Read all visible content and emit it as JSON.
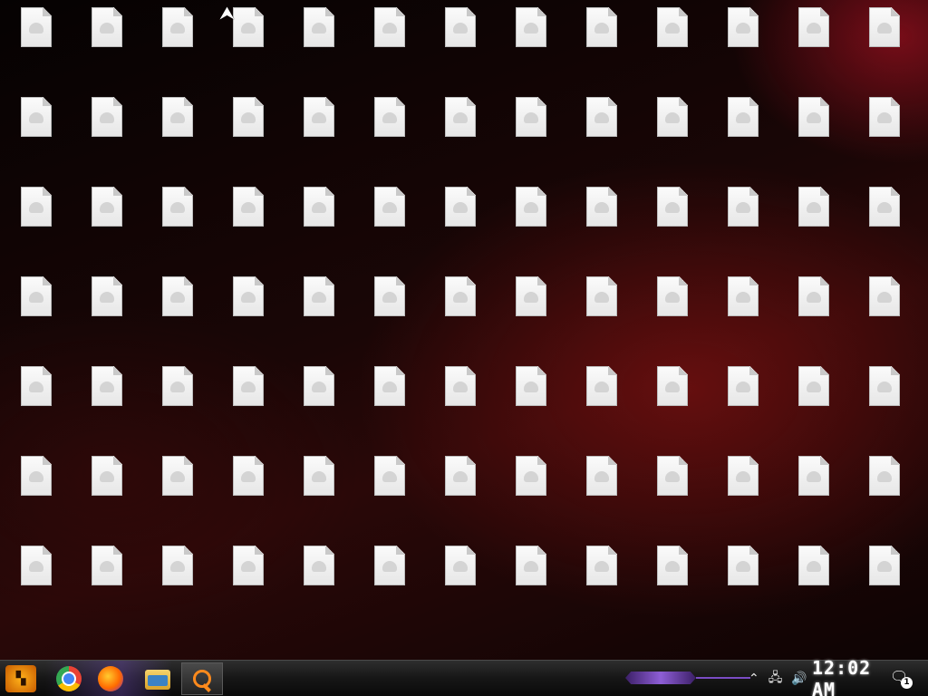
{
  "desktop": {
    "columns": 13,
    "rows": 7,
    "icon_type": "generic-file-icon",
    "labels": [
      "",
      "",
      "",
      "",
      "",
      "",
      "",
      "",
      "",
      "",
      "",
      "",
      "",
      "",
      "",
      "",
      "",
      "",
      "",
      "",
      "",
      "",
      "",
      "",
      "",
      "",
      "",
      "",
      "",
      "",
      "",
      "",
      "",
      "",
      "",
      "",
      "",
      "",
      "",
      "",
      "",
      "",
      "",
      "",
      "",
      "",
      "",
      "",
      "",
      "",
      "",
      "",
      "",
      "",
      "",
      "",
      "",
      "",
      "",
      "",
      "",
      "",
      "",
      "",
      "",
      "",
      "",
      "",
      "",
      "",
      "",
      "",
      "",
      "",
      "",
      "",
      "",
      "",
      "",
      "",
      "",
      "",
      "",
      "",
      "",
      "",
      "",
      "",
      "",
      "",
      ""
    ]
  },
  "taskbar": {
    "start_icon": "start-logo",
    "pinned": [
      "chrome-icon",
      "firefox-icon",
      "file-explorer-icon"
    ],
    "search_icon": "search-icon",
    "tray_icons": [
      "chevron-up-icon",
      "network-icon",
      "volume-icon"
    ],
    "clock": "12:02 AM",
    "notification_count": "1"
  },
  "colors": {
    "accent_purple": "#8e5ed6",
    "search_orange": "#ff8a1c",
    "start_orange": "#ffb21a"
  }
}
